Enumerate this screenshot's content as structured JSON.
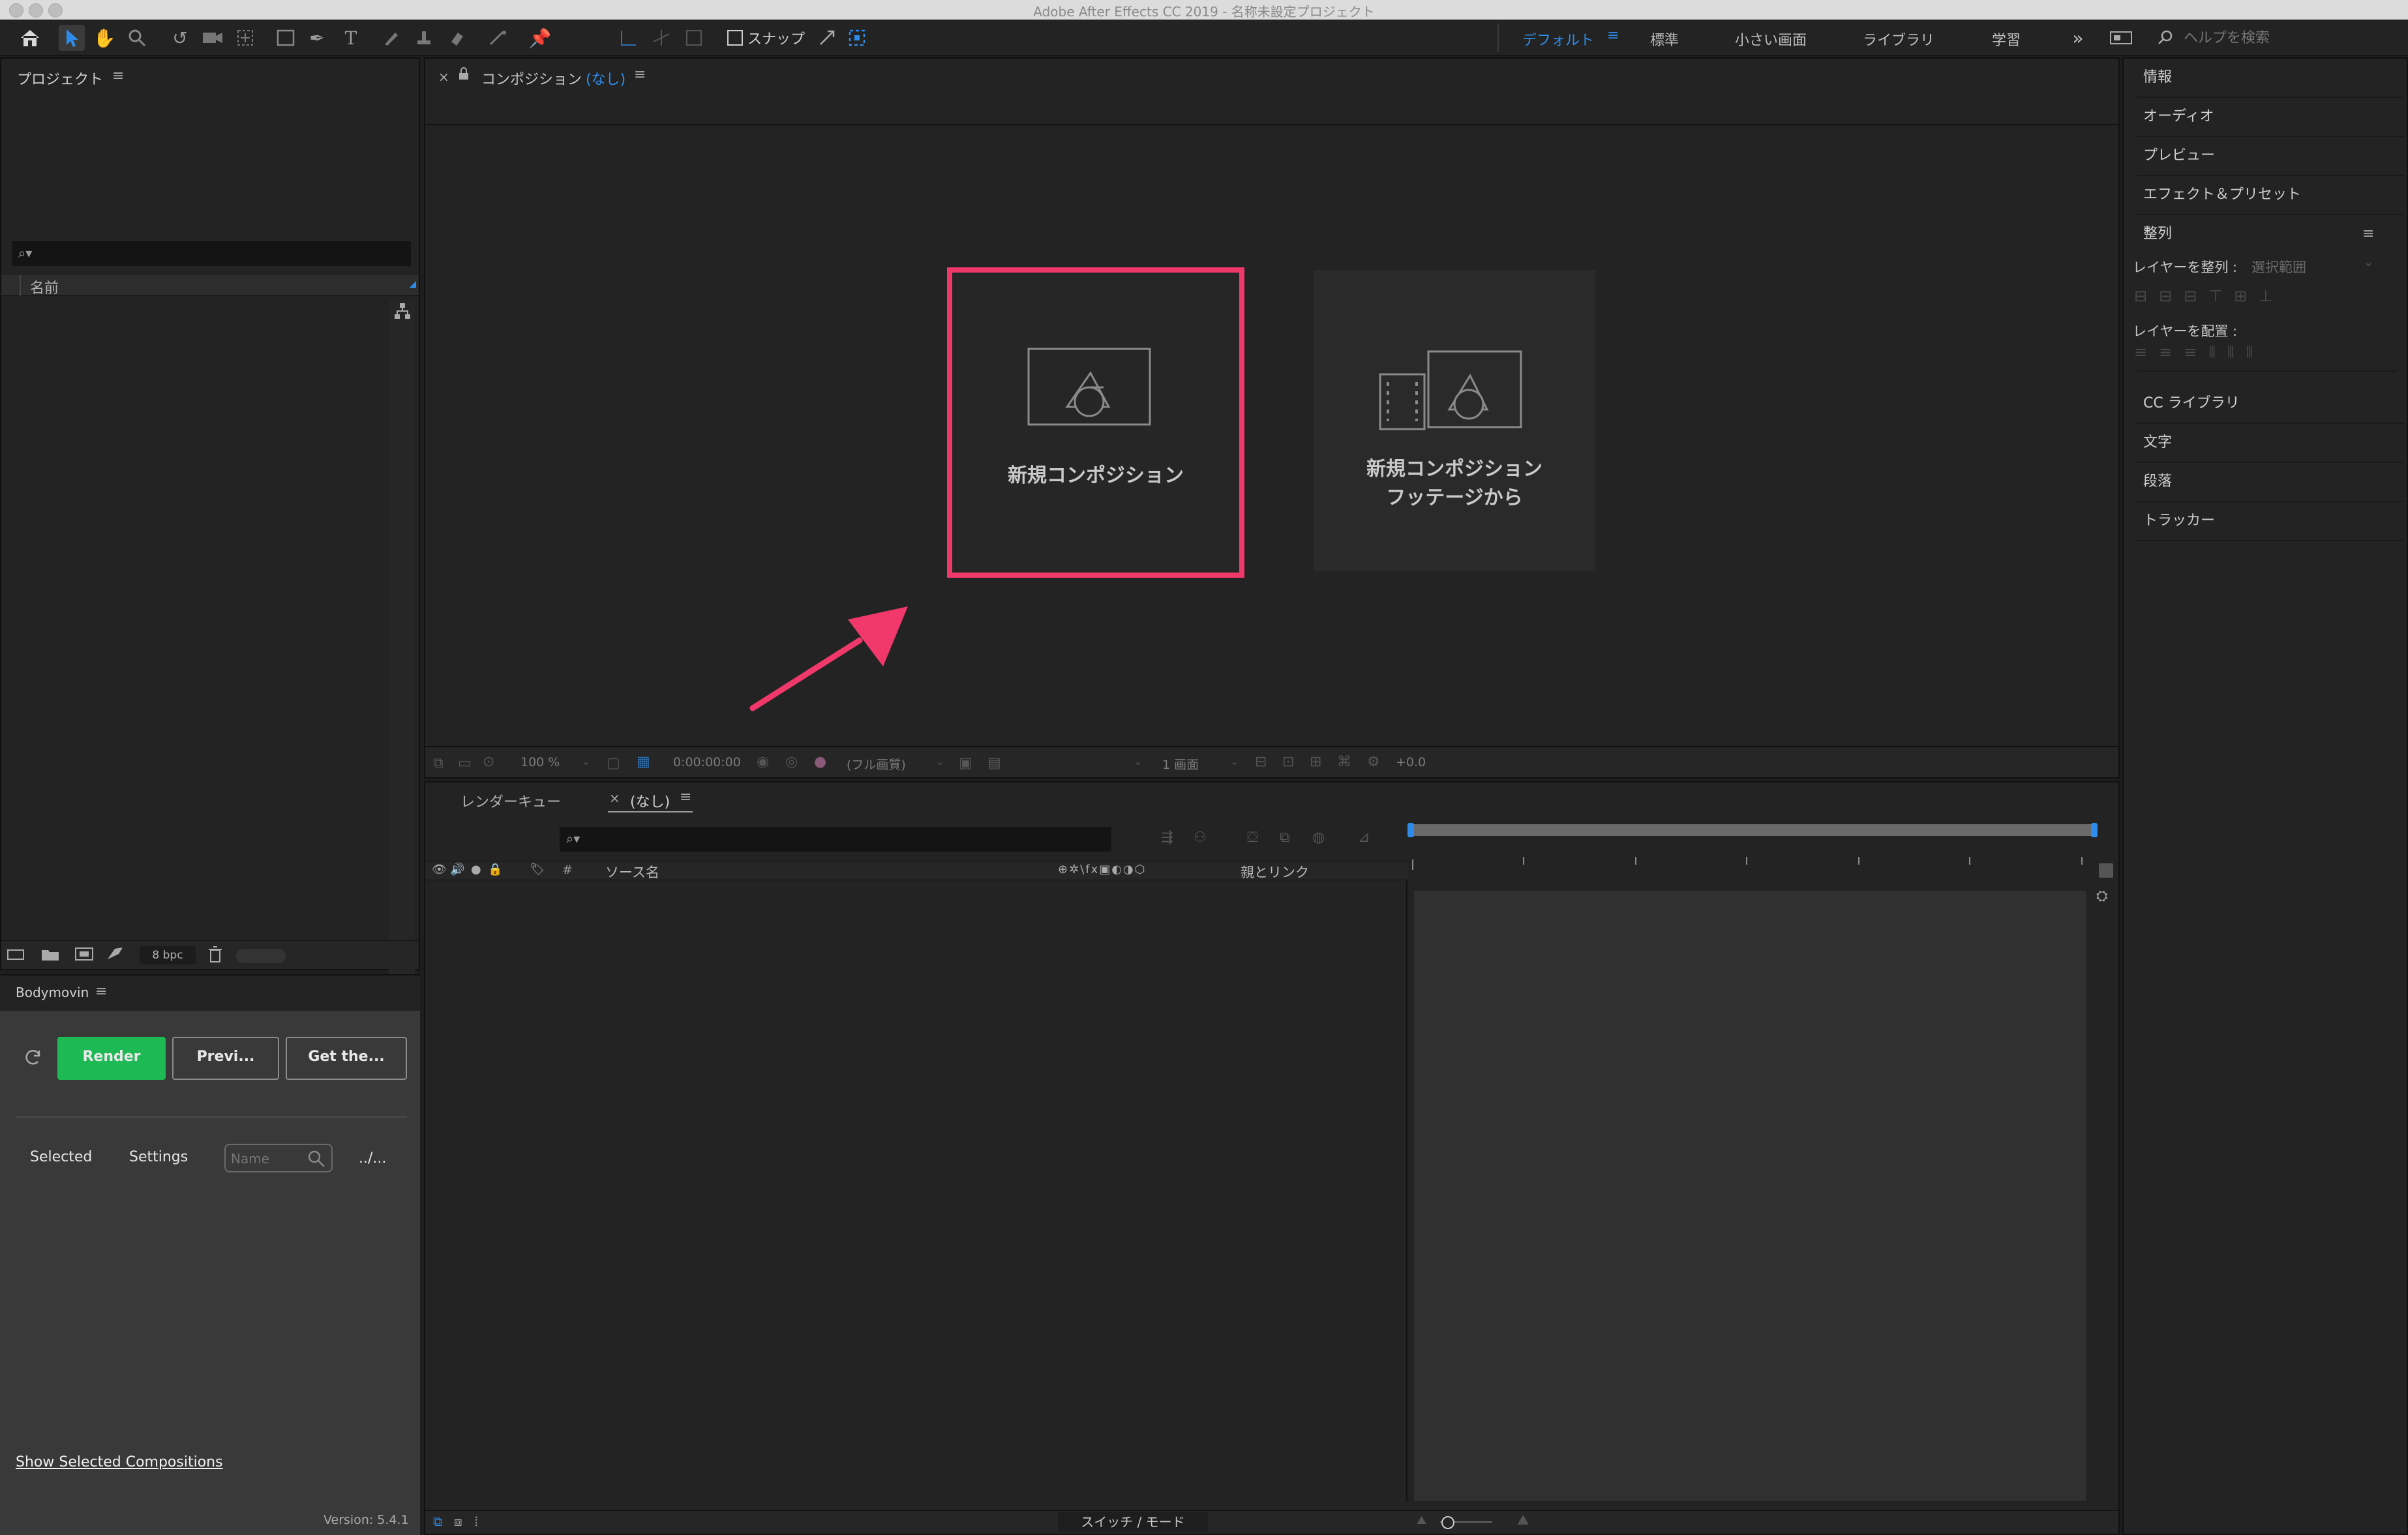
{
  "app": {
    "window_title": "Adobe After Effects CC 2019 - 名称未設定プロジェクト"
  },
  "toolbar": {
    "snap_label": "スナップ",
    "workspaces": [
      "デフォルト",
      "標準",
      "小さい画面",
      "ライブラリ",
      "学習"
    ],
    "active_workspace": "デフォルト",
    "help_search_placeholder": "ヘルプを検索"
  },
  "project_panel": {
    "title": "プロジェクト",
    "column_name": "名前",
    "bit_depth": "8 bpc"
  },
  "bodymovin": {
    "title": "Bodymovin",
    "render_label": "Render",
    "preview_label": "Previ...",
    "get_label": "Get the...",
    "tab_selected": "Selected",
    "tab_settings": "Settings",
    "name_placeholder": "Name",
    "path_label": "../...",
    "show_selected_link": "Show Selected Compositions",
    "version": "Version: 5.4.1",
    "colors": {
      "render_bg": "#1db954"
    }
  },
  "composition": {
    "tab_label": "コンポジション",
    "tab_value": "(なし)",
    "new_comp_label": "新規コンポジション",
    "new_comp_from_footage_line1": "新規コンポジション",
    "new_comp_from_footage_line2": "フッテージから",
    "zoom": "100 %",
    "timecode": "0:00:00:00",
    "quality": "(フル画質)",
    "view_count": "1 画面",
    "exposure": "+0.0",
    "highlight_color": "#f0386b"
  },
  "timeline": {
    "tab_render_queue": "レンダーキュー",
    "tab_comp": "(なし)",
    "col_hash": "#",
    "col_source_name": "ソース名",
    "col_parent": "親とリンク",
    "footer_toggle": "スイッチ / モード"
  },
  "right_panel": {
    "items": [
      "情報",
      "オーディオ",
      "プレビュー",
      "エフェクト＆プリセット"
    ],
    "align": {
      "title": "整列",
      "align_layers_label": "レイヤーを整列 :",
      "align_target": "選択範囲",
      "distribute_label": "レイヤーを配置 :"
    },
    "items_after": [
      "CC ライブラリ",
      "文字",
      "段落",
      "トラッカー"
    ]
  }
}
